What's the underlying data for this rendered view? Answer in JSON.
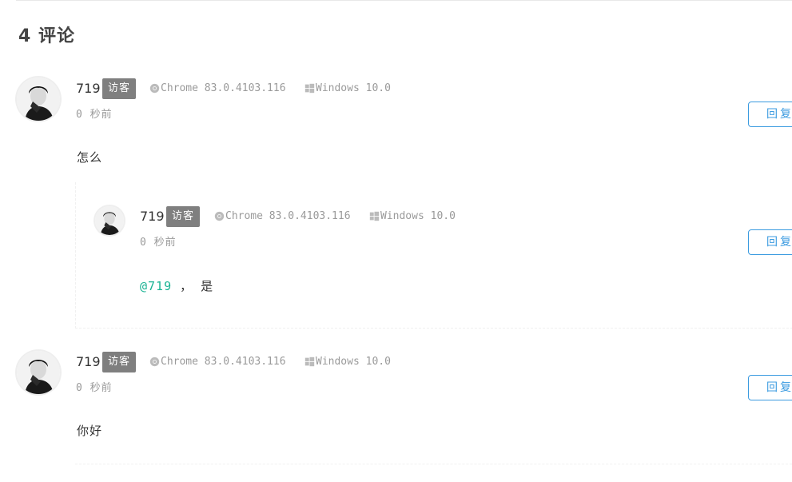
{
  "comments_header": {
    "count": "4",
    "title": "评论"
  },
  "comments": [
    {
      "author": "719",
      "badge": "访客",
      "browser": "Chrome 83.0.4103.116",
      "os": "Windows 10.0",
      "time": "0 秒前",
      "reply_label": "回复",
      "content": "怎么",
      "replies": [
        {
          "author": "719",
          "badge": "访客",
          "browser": "Chrome 83.0.4103.116",
          "os": "Windows 10.0",
          "time": "0 秒前",
          "reply_label": "回复",
          "mention": "@719",
          "content": " ， 是"
        }
      ]
    },
    {
      "author": "719",
      "badge": "访客",
      "browser": "Chrome 83.0.4103.116",
      "os": "Windows 10.0",
      "time": "0 秒前",
      "reply_label": "回复",
      "content": "你好"
    }
  ],
  "icons": {
    "browser": "chrome-icon",
    "os": "windows-icon"
  },
  "colors": {
    "accent": "#3b9be0",
    "mention": "#1bb394",
    "badge": "#7f7f7f"
  }
}
